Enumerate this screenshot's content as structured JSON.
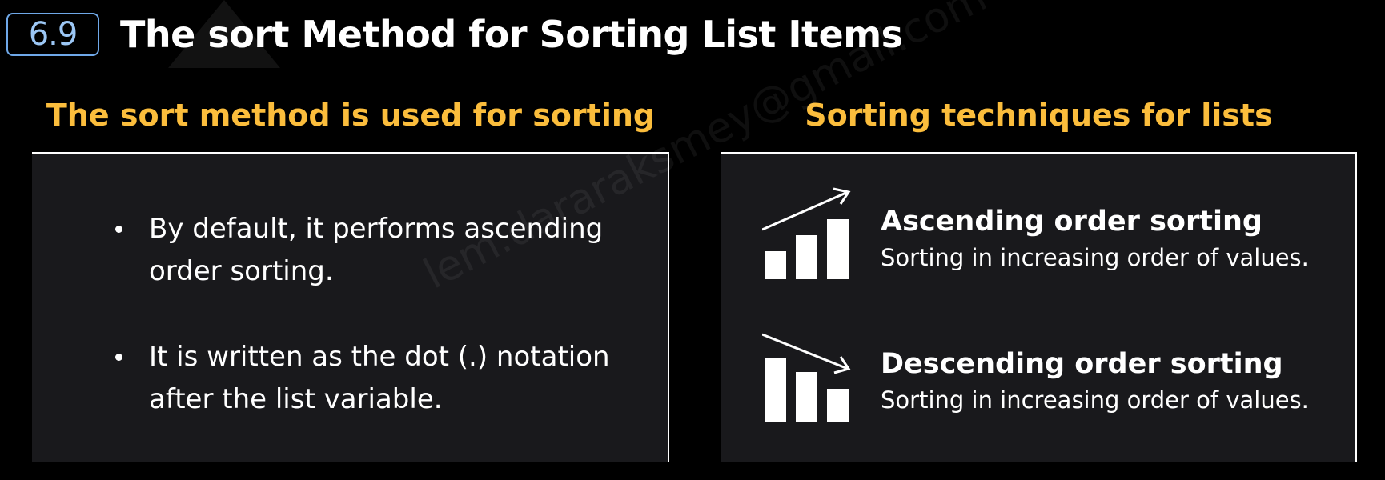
{
  "header": {
    "section_number": "6.9",
    "title": "The sort Method for Sorting List Items"
  },
  "left_column": {
    "heading": "The sort method is used for sorting",
    "bullets": [
      "By default, it performs ascending order sorting.",
      "It is written as the dot (.) notation after the list variable."
    ]
  },
  "right_column": {
    "heading": "Sorting techniques for lists",
    "techniques": [
      {
        "title": "Ascending order sorting",
        "description": "Sorting in increasing order of values.",
        "icon": "ascending-bar-chart-icon"
      },
      {
        "title": "Descending order sorting",
        "description": "Sorting in increasing order of values.",
        "icon": "descending-bar-chart-icon"
      }
    ]
  },
  "watermark": "lem.dararaksmey@gmail.com",
  "colors": {
    "background": "#000000",
    "panel": "#1a1a1d",
    "heading_accent": "#fbbd3c",
    "badge_border": "#6fa8e8",
    "badge_text": "#9cc7f5",
    "text": "#ffffff"
  }
}
